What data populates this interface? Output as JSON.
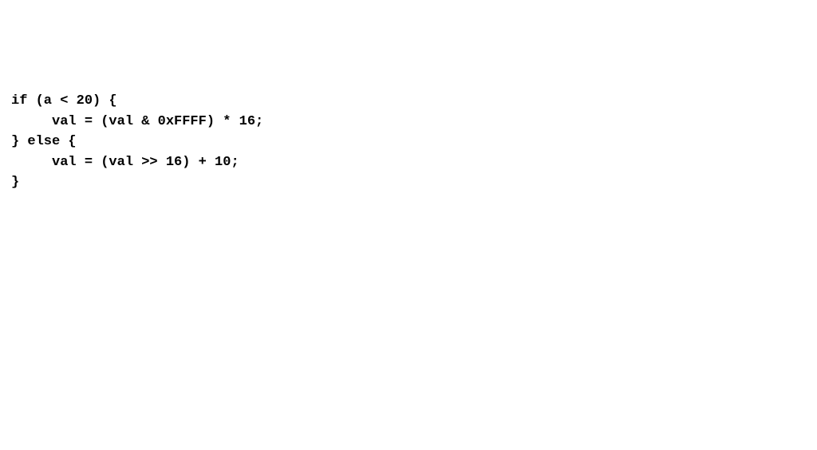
{
  "code": {
    "line1": "if (a < 20) {",
    "line2": "     val = (val & 0xFFFF) * 16;",
    "line3": "} else {",
    "line4": "     val = (val >> 16) + 10;",
    "line5": "}"
  }
}
